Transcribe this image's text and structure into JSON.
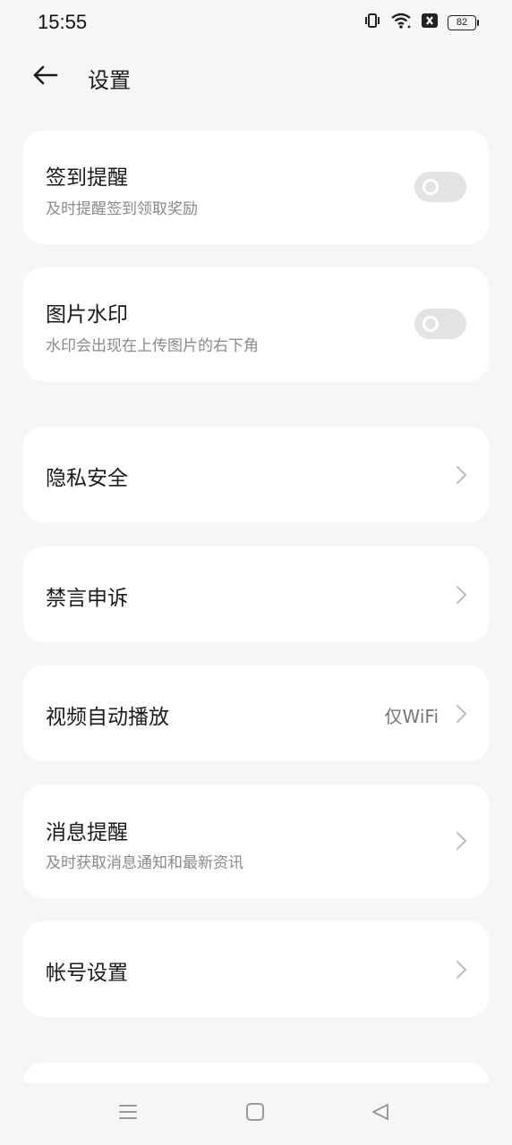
{
  "status_bar": {
    "time": "15:55",
    "battery": "82",
    "icons": [
      "vibrate-icon",
      "wifi-icon",
      "no-sim-icon",
      "battery-icon"
    ]
  },
  "header": {
    "title": "设置",
    "back_icon": "back-arrow-icon"
  },
  "settings": {
    "checkin_reminder": {
      "title": "签到提醒",
      "subtitle": "及时提醒签到领取奖励",
      "enabled": false
    },
    "image_watermark": {
      "title": "图片水印",
      "subtitle": "水印会出现在上传图片的右下角",
      "enabled": false
    },
    "privacy": {
      "title": "隐私安全"
    },
    "mute_appeal": {
      "title": "禁言申诉"
    },
    "video_autoplay": {
      "title": "视频自动播放",
      "value": "仅WiFi"
    },
    "message_reminder": {
      "title": "消息提醒",
      "subtitle": "及时获取消息通知和最新资讯"
    },
    "account_settings": {
      "title": "帐号设置"
    }
  },
  "nav_bar": {
    "icons": [
      "menu-icon",
      "home-icon",
      "back-icon"
    ]
  },
  "colors": {
    "background": "#f6f6f6",
    "card": "#ffffff",
    "toggle_off": "#e3e3e3",
    "secondary_text": "#8a8a8a"
  }
}
